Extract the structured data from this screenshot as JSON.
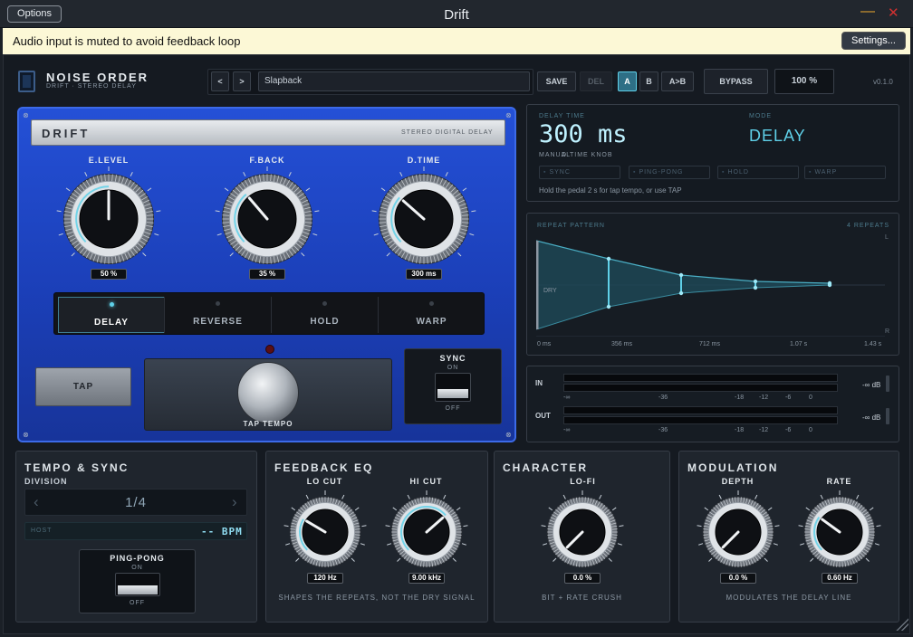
{
  "window": {
    "title": "Drift",
    "options_label": "Options",
    "minimize_glyph": "—",
    "close_glyph": "✕"
  },
  "warning": {
    "text": "Audio input is muted to avoid feedback loop",
    "settings_label": "Settings..."
  },
  "brand": {
    "name": "NOISE ORDER",
    "subtitle": "DRIFT · STEREO DELAY",
    "version": "v0.1.0"
  },
  "preset_bar": {
    "prev": "<",
    "next": ">",
    "preset_name": "Slapback",
    "save": "SAVE",
    "del": "DEL",
    "a": "A",
    "b": "B",
    "ab": "A>B",
    "bypass": "BYPASS",
    "zoom": "100 %"
  },
  "pedal": {
    "title": "DRIFT",
    "subtitle": "STEREO DIGITAL DELAY",
    "knobs": [
      {
        "label": "E.LEVEL",
        "value": "50 %",
        "level": 0.5
      },
      {
        "label": "F.BACK",
        "value": "35 %",
        "level": 0.35
      },
      {
        "label": "D.TIME",
        "value": "300 ms",
        "level": 0.32
      }
    ],
    "modes": [
      "DELAY",
      "REVERSE",
      "HOLD",
      "WARP"
    ],
    "active_mode": 0,
    "tap_label": "TAP",
    "tap_tempo_label": "TAP TEMPO",
    "sync": {
      "label": "SYNC",
      "on": "ON",
      "off": "OFF"
    }
  },
  "readout": {
    "delay_time_label": "DELAY TIME",
    "delay_time": "300 ms",
    "mode_label": "MODE",
    "mode": "DELAY",
    "manual": "MANUAL",
    "source": "D.TIME KNOB",
    "chips": [
      "SYNC",
      "PING-PONG",
      "HOLD",
      "WARP"
    ],
    "hint": "Hold the pedal 2 s for tap tempo, or use TAP"
  },
  "pattern": {
    "title": "REPEAT PATTERN",
    "repeats": "4 REPEATS",
    "dry": "DRY",
    "l": "L",
    "r": "R",
    "x_ticks": [
      "0 ms",
      "356 ms",
      "712 ms",
      "1.07 s",
      "1.43 s"
    ]
  },
  "meters": {
    "in": "IN",
    "out": "OUT",
    "in_value": "-∞ dB",
    "out_value": "-∞ dB",
    "ticks": [
      "-∞",
      "-36",
      "-18",
      "-12",
      "-6",
      "0"
    ]
  },
  "tempo": {
    "title": "TEMPO & SYNC",
    "division_label": "DIVISION",
    "division": "1/4",
    "prev": "‹",
    "next": "›",
    "host": "HOST",
    "bpm": "-- BPM",
    "pingpong": {
      "label": "PING-PONG",
      "on": "ON",
      "off": "OFF"
    }
  },
  "feedback_eq": {
    "title": "FEEDBACK EQ",
    "knobs": [
      {
        "label": "LO CUT",
        "value": "120 Hz",
        "level": 0.28
      },
      {
        "label": "HI CUT",
        "value": "9.00 kHz",
        "level": 0.68
      }
    ],
    "caption": "SHAPES THE REPEATS, NOT THE DRY SIGNAL"
  },
  "character": {
    "title": "CHARACTER",
    "knobs": [
      {
        "label": "LO-FI",
        "value": "0.0 %",
        "level": 0.0
      }
    ],
    "caption": "BIT + RATE CRUSH"
  },
  "modulation": {
    "title": "MODULATION",
    "knobs": [
      {
        "label": "DEPTH",
        "value": "0.0 %",
        "level": 0.0
      },
      {
        "label": "RATE",
        "value": "0.60 Hz",
        "level": 0.3
      }
    ],
    "caption": "MODULATES THE DELAY LINE"
  },
  "colors": {
    "accent": "#5fd0e8",
    "pedal_blue": "#1f44c8",
    "warning_bg": "#fcf8d6"
  }
}
